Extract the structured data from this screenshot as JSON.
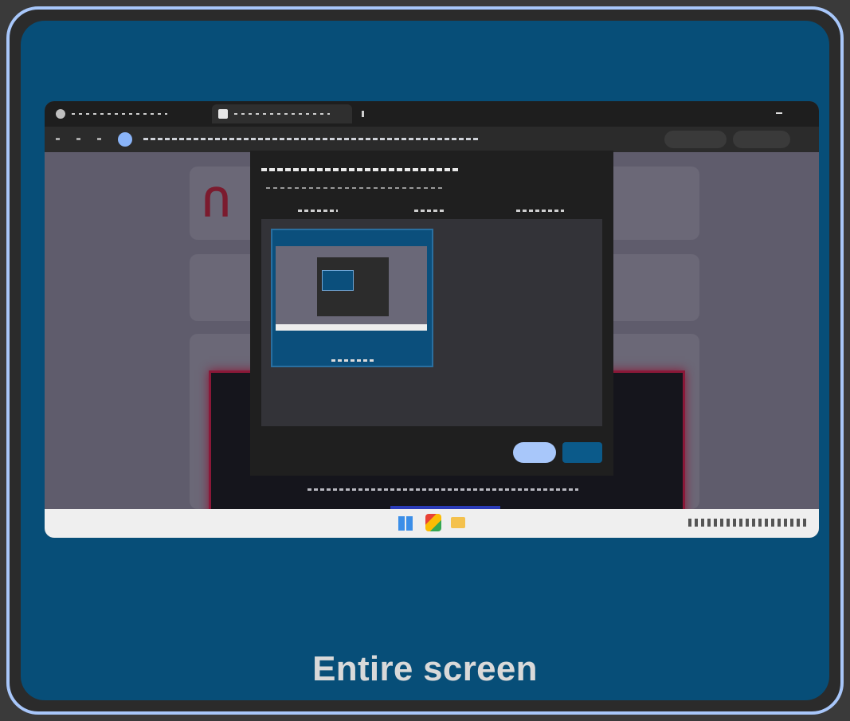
{
  "source_tile": {
    "label": "Entire screen"
  }
}
